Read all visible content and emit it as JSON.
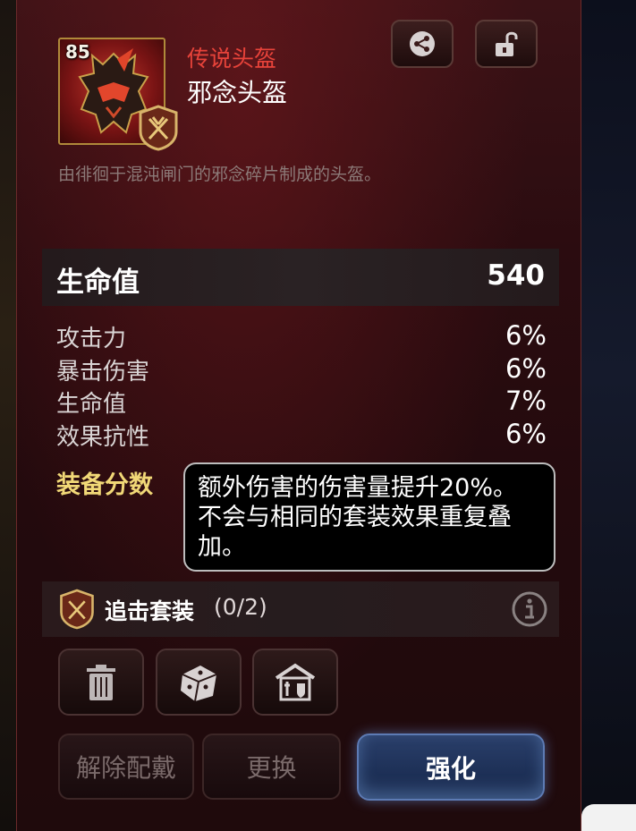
{
  "item": {
    "level": "85",
    "rarity": "传说头盔",
    "name": "邪念头盔",
    "description": "由徘徊于混沌闸门的邪念碎片制成的头盔。",
    "icon": "demon-helmet-icon",
    "set_badge_icon": "pursuit-set-badge-icon"
  },
  "header_buttons": {
    "share_icon": "share-icon",
    "lock_icon": "unlock-icon"
  },
  "main_stat": {
    "label": "生命值",
    "value": "540"
  },
  "sub_stats": [
    {
      "label": "攻击力",
      "value": "6%"
    },
    {
      "label": "暴击伤害",
      "value": "6%"
    },
    {
      "label": "生命值",
      "value": "7%"
    },
    {
      "label": "效果抗性",
      "value": "6%"
    }
  ],
  "gear_score_label": "装备分数",
  "tooltip": {
    "line1": "额外伤害的伤害量提升20%。",
    "line2": "不会与相同的套装效果重复叠",
    "line3": "加。"
  },
  "set": {
    "name": "追击套装",
    "count": "(0/2)",
    "info_icon": "info-icon"
  },
  "tool_buttons": [
    "trash-icon",
    "dice-icon",
    "storage-icon"
  ],
  "actions": {
    "unequip": "解除配戴",
    "swap": "更换",
    "enhance": "强化"
  },
  "colors": {
    "rarity": "#e8433a",
    "gear_score": "#f1d877",
    "enhance_button": "#1e3158",
    "panel": "#2b0c10"
  }
}
